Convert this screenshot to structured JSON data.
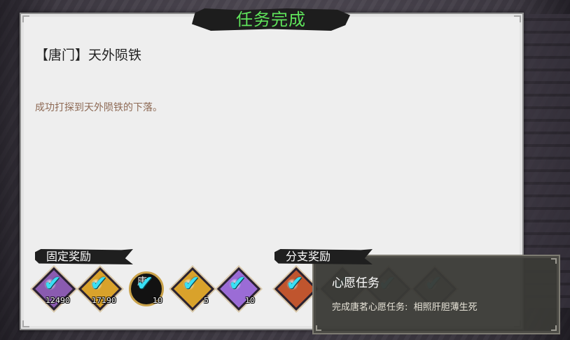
{
  "dialog": {
    "title": "任务完成",
    "quest_name": "【唐门】天外陨铁",
    "quest_desc": "成功打探到天外陨铁的下落。"
  },
  "fixed_rewards": {
    "label": "固定奖励",
    "items": [
      {
        "icon": "purple-orb-icon",
        "count": "12490",
        "color": "#8a5bb0"
      },
      {
        "icon": "gold-coin-icon",
        "count": "17190",
        "color": "#d9a22b"
      },
      {
        "icon": "tang-sect-emblem-icon",
        "count": "10",
        "color": "#c9a24a",
        "char": "唐"
      },
      {
        "icon": "gold-orb-icon",
        "count": "5",
        "color": "#d9a22b"
      },
      {
        "icon": "violet-orb-icon",
        "count": "10",
        "color": "#9b6cd6"
      }
    ]
  },
  "branch_rewards": {
    "label": "分支奖励",
    "items": [
      {
        "icon": "scroll-item-icon",
        "color": "#c0552e"
      },
      {
        "icon": "dark-ring-icon",
        "color": "#4c4c4c"
      },
      {
        "icon": "jade-disc-icon",
        "color": "#7a7a7a"
      },
      {
        "icon": "lotus-disc-icon",
        "color": "#888888"
      }
    ]
  },
  "tooltip": {
    "title": "心愿任务",
    "desc": "完成唐茗心愿任务:  相照肝胆薄生死"
  },
  "colors": {
    "title_green": "#5fe35b",
    "check_cyan": "#39e0f5",
    "desc_brown": "#8e6a55"
  }
}
